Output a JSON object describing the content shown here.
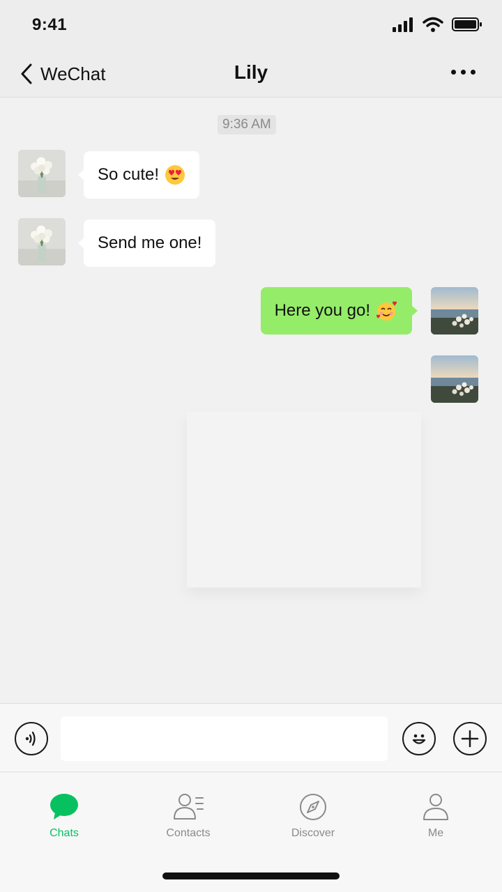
{
  "status_bar": {
    "time": "9:41"
  },
  "nav": {
    "back_label": "WeChat",
    "title": "Lily"
  },
  "chat": {
    "timestamp": "9:36 AM",
    "messages": [
      {
        "direction": "in",
        "text": "So cute!",
        "emoji": "heart-eyes-emoji"
      },
      {
        "direction": "in",
        "text": "Send me one!"
      },
      {
        "direction": "out",
        "text": "Here you go!",
        "emoji": "smiling-face-with-hearts-emoji"
      },
      {
        "direction": "out",
        "text": ""
      }
    ]
  },
  "input": {
    "placeholder": ""
  },
  "tabs": [
    {
      "label": "Chats",
      "icon": "chat-bubble-icon",
      "active": true
    },
    {
      "label": "Contacts",
      "icon": "contacts-icon",
      "active": false
    },
    {
      "label": "Discover",
      "icon": "compass-icon",
      "active": false
    },
    {
      "label": "Me",
      "icon": "person-icon",
      "active": false
    }
  ],
  "colors": {
    "accent": "#07c160",
    "outgoing_bubble": "#95ec69",
    "incoming_bubble": "#ffffff",
    "background": "#f1f1f1"
  }
}
